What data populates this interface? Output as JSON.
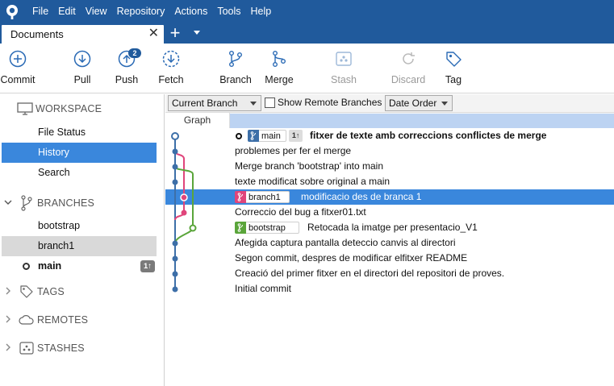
{
  "menu": [
    "File",
    "Edit",
    "View",
    "Repository",
    "Actions",
    "Tools",
    "Help"
  ],
  "tab": {
    "label": "Documents",
    "close": "✕",
    "new": "+"
  },
  "toolbar": {
    "commit": "Commit",
    "pull": "Pull",
    "push": "Push",
    "push_badge": "2",
    "fetch": "Fetch",
    "branch": "Branch",
    "merge": "Merge",
    "stash": "Stash",
    "discard": "Discard",
    "tag": "Tag"
  },
  "sidebar": {
    "workspace": "WORKSPACE",
    "workspace_items": [
      "File Status",
      "History",
      "Search"
    ],
    "branches": "BRANCHES",
    "branch_items": [
      "bootstrap",
      "branch1",
      "main"
    ],
    "main_badge": "1↑",
    "tags": "TAGS",
    "remotes": "REMOTES",
    "stashes": "STASHES"
  },
  "filter": {
    "branch_dropdown": "Current Branch",
    "show_remote": "Show Remote Branches",
    "order_dropdown": "Date Order"
  },
  "graph_header": "Graph",
  "commits": [
    {
      "message": "fitxer de texte amb correccions conflictes de merge",
      "branch": "main",
      "ahead": "1↑"
    },
    {
      "message": "problemes per fer el merge"
    },
    {
      "message": "Merge branch 'bootstrap' into main"
    },
    {
      "message": "texte modificat sobre original a main"
    },
    {
      "message": "modificacio des de branca 1",
      "branch": "branch1"
    },
    {
      "message": "Correccio del bug a fitxer01.txt"
    },
    {
      "message": "Retocada la imatge per presentacio_V1",
      "branch": "bootstrap"
    },
    {
      "message": "Afegida captura pantalla deteccio canvis al directori"
    },
    {
      "message": "Segon commit, despres de modificar elfitxer README"
    },
    {
      "message": "Creació del primer fitxer en el directori del repositori de proves."
    },
    {
      "message": "Initial commit"
    }
  ],
  "colors": {
    "accent": "#205a9c",
    "selection": "#3a87dc",
    "main_line": "#3d6fa8",
    "branch1_line": "#e0457b",
    "bootstrap_line": "#5aa53a"
  }
}
